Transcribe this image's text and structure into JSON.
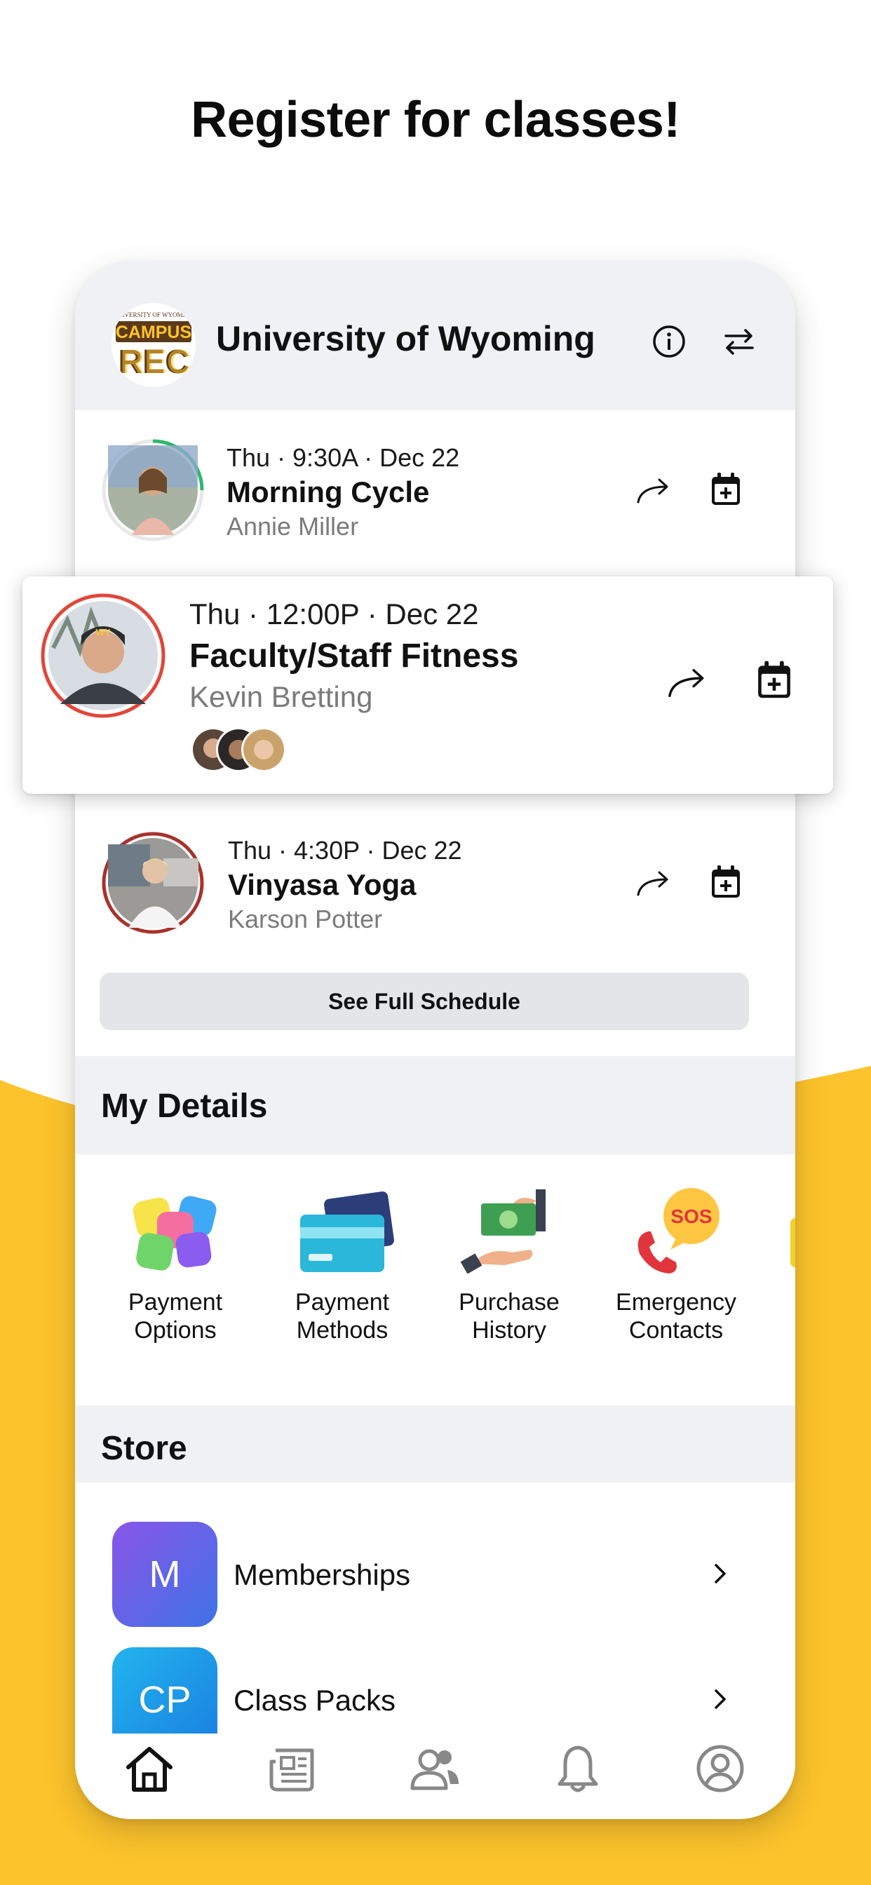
{
  "headline": "Register for classes!",
  "colors": {
    "accent": "#FCC32C",
    "ring_green": "#2EB86B",
    "ring_red": "#E0473A",
    "ring_dark_red": "#A8322B"
  },
  "header": {
    "logo_text_top": "UNIVERSITY of WYOMING",
    "logo_text_mid": "CAMPUS",
    "logo_text_bottom": "REC",
    "org_name": "University of Wyoming",
    "icons": [
      "info-icon",
      "switch-icon"
    ]
  },
  "classes": [
    {
      "time": "Thu · 9:30A · Dec 22",
      "name": "Morning Cycle",
      "instructor": "Annie Miller"
    },
    {
      "time": "Thu · 12:00P · Dec 22",
      "name": "Faculty/Staff Fitness",
      "instructor": "Kevin Bretting"
    },
    {
      "time": "Thu · 4:30P · Dec 22",
      "name": "Vinyasa Yoga",
      "instructor": "Karson Potter"
    }
  ],
  "see_full_schedule": "See Full Schedule",
  "my_details": {
    "title": "My Details",
    "items": [
      {
        "line1": "Payment",
        "line2": "Options",
        "icon": "payment-options-icon"
      },
      {
        "line1": "Payment",
        "line2": "Methods",
        "icon": "credit-card-icon"
      },
      {
        "line1": "Purchase",
        "line2": "History",
        "icon": "money-hand-icon"
      },
      {
        "line1": "Emergency",
        "line2": "Contacts",
        "icon": "sos-phone-icon"
      }
    ]
  },
  "store": {
    "title": "Store",
    "items": [
      {
        "badge": "M",
        "label": "Memberships",
        "color": "#5B63E6"
      },
      {
        "badge": "CP",
        "label": "Class Packs",
        "color": "#1DA1E8"
      }
    ]
  },
  "tabs": [
    "home-icon",
    "news-icon",
    "people-icon",
    "bell-icon",
    "profile-icon"
  ]
}
